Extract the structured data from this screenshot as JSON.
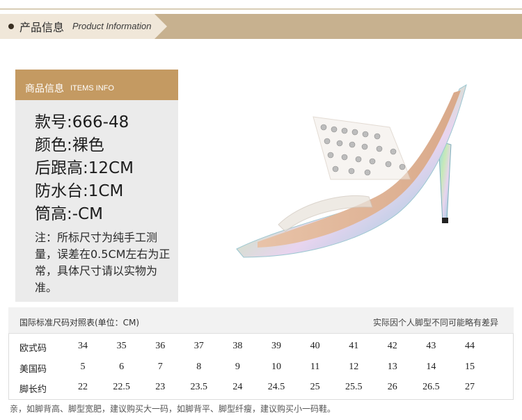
{
  "banner": {
    "title_cn": "产品信息",
    "title_en": "Product Information"
  },
  "info": {
    "head_cn": "商品信息",
    "head_en": "ITEMS INFO",
    "specs": [
      "款号:666-48",
      "颜色:裸色",
      "后跟高:12CM",
      "防水台:1CM",
      "筒高:-CM"
    ],
    "note": "注：所标尺寸为纯手工测量，误差在0.5CM左右为正常，具体尺寸请以实物为准。"
  },
  "product": {
    "icon": "high-heel-sandal-image"
  },
  "size_table": {
    "title": "国际标准尺码对照表(单位：CM)",
    "note": "实际因个人脚型不同可能略有差异",
    "rows": [
      {
        "label": "欧式码",
        "values": [
          "34",
          "35",
          "36",
          "37",
          "38",
          "39",
          "40",
          "41",
          "42",
          "43",
          "44"
        ]
      },
      {
        "label": "美国码",
        "values": [
          "5",
          "6",
          "7",
          "8",
          "9",
          "10",
          "11",
          "12",
          "13",
          "14",
          "15"
        ]
      },
      {
        "label": "脚长约",
        "values": [
          "22",
          "22.5",
          "23",
          "23.5",
          "24",
          "24.5",
          "25",
          "25.5",
          "26",
          "26.5",
          "27"
        ]
      }
    ]
  },
  "footer": "亲，如脚背高、脚型宽肥，建议购买大一码，如脚背平、脚型纤瘦，建议购买小一码鞋。"
}
